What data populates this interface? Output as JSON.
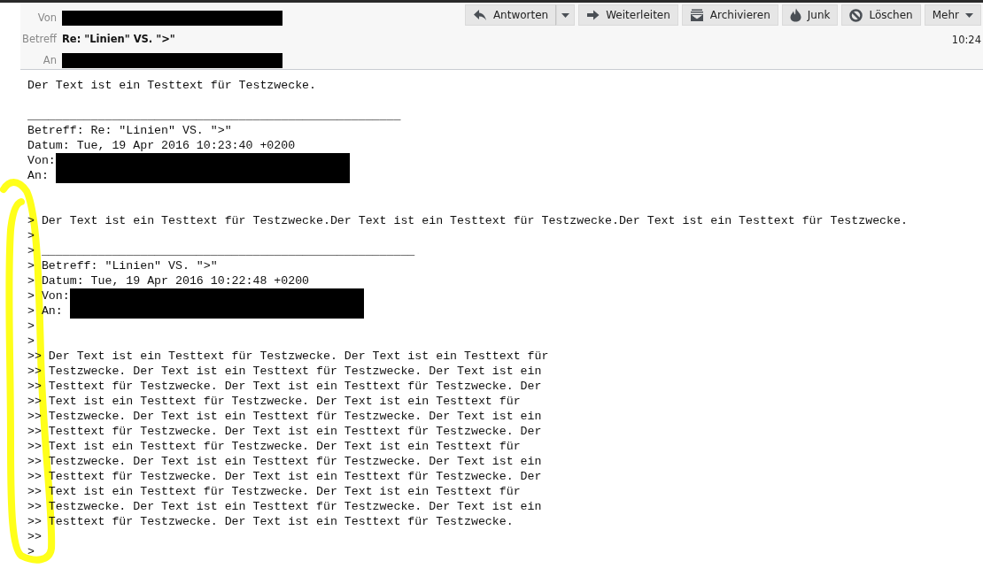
{
  "header": {
    "fields": [
      {
        "label": "Von",
        "kind": "redacted"
      },
      {
        "label": "Betreff",
        "kind": "subject",
        "value": "Re: \"Linien\" VS. \">\""
      },
      {
        "label": "An",
        "kind": "redacted"
      }
    ],
    "time": "10:24",
    "buttons": [
      {
        "label": "Antworten",
        "kind": "reply"
      },
      {
        "label": "Weiterleiten",
        "kind": "forward"
      },
      {
        "label": "Archivieren",
        "kind": "archive"
      },
      {
        "label": "Junk",
        "kind": "junk"
      },
      {
        "label": "Löschen",
        "kind": "delete"
      },
      {
        "label": "Mehr",
        "kind": "more"
      }
    ]
  },
  "body": {
    "lines": [
      {
        "kind": "text",
        "text": "Der Text ist ein Testtext für Testzwecke."
      },
      {
        "kind": "blank"
      },
      {
        "kind": "text",
        "text": "_____________________________________________________"
      },
      {
        "kind": "text",
        "text": "Betreff: Re: \"Linien\" VS. \">\""
      },
      {
        "kind": "text",
        "text": "Datum: Tue, 19 Apr 2016 10:23:40 +0200"
      },
      {
        "kind": "redacted",
        "text": "Von:"
      },
      {
        "kind": "text",
        "text": "An:"
      },
      {
        "kind": "blank"
      },
      {
        "kind": "blank"
      },
      {
        "kind": "text",
        "text": "> Der Text ist ein Testtext für Testzwecke.Der Text ist ein Testtext für Testzwecke.Der Text ist ein Testtext für Testzwecke."
      },
      {
        "kind": "text",
        "text": ">"
      },
      {
        "kind": "text",
        "text": "> _____________________________________________________"
      },
      {
        "kind": "text",
        "text": "> Betreff: \"Linien\" VS. \">\""
      },
      {
        "kind": "text",
        "text": "> Datum: Tue, 19 Apr 2016 10:22:48 +0200"
      },
      {
        "kind": "redacted",
        "text": "> Von:"
      },
      {
        "kind": "text",
        "text": "> An:"
      },
      {
        "kind": "text",
        "text": ">"
      },
      {
        "kind": "text",
        "text": ">"
      },
      {
        "kind": "text",
        "text": ">> Der Text ist ein Testtext für Testzwecke. Der Text ist ein Testtext für"
      },
      {
        "kind": "text",
        "text": ">> Testzwecke. Der Text ist ein Testtext für Testzwecke. Der Text ist ein"
      },
      {
        "kind": "text",
        "text": ">> Testtext für Testzwecke. Der Text ist ein Testtext für Testzwecke. Der"
      },
      {
        "kind": "text",
        "text": ">> Text ist ein Testtext für Testzwecke. Der Text ist ein Testtext für"
      },
      {
        "kind": "text",
        "text": ">> Testzwecke. Der Text ist ein Testtext für Testzwecke. Der Text ist ein"
      },
      {
        "kind": "text",
        "text": ">> Testtext für Testzwecke. Der Text ist ein Testtext für Testzwecke. Der"
      },
      {
        "kind": "text",
        "text": ">> Text ist ein Testtext für Testzwecke. Der Text ist ein Testtext für"
      },
      {
        "kind": "text",
        "text": ">> Testzwecke. Der Text ist ein Testtext für Testzwecke. Der Text ist ein"
      },
      {
        "kind": "text",
        "text": ">> Testtext für Testzwecke. Der Text ist ein Testtext für Testzwecke. Der"
      },
      {
        "kind": "text",
        "text": ">> Text ist ein Testtext für Testzwecke. Der Text ist ein Testtext für"
      },
      {
        "kind": "text",
        "text": ">> Testzwecke. Der Text ist ein Testtext für Testzwecke. Der Text ist ein"
      },
      {
        "kind": "text",
        "text": ">> Testtext für Testzwecke. Der Text ist ein Testtext für Testzwecke."
      },
      {
        "kind": "text",
        "text": ">>"
      },
      {
        "kind": "text",
        "text": ">"
      }
    ]
  }
}
